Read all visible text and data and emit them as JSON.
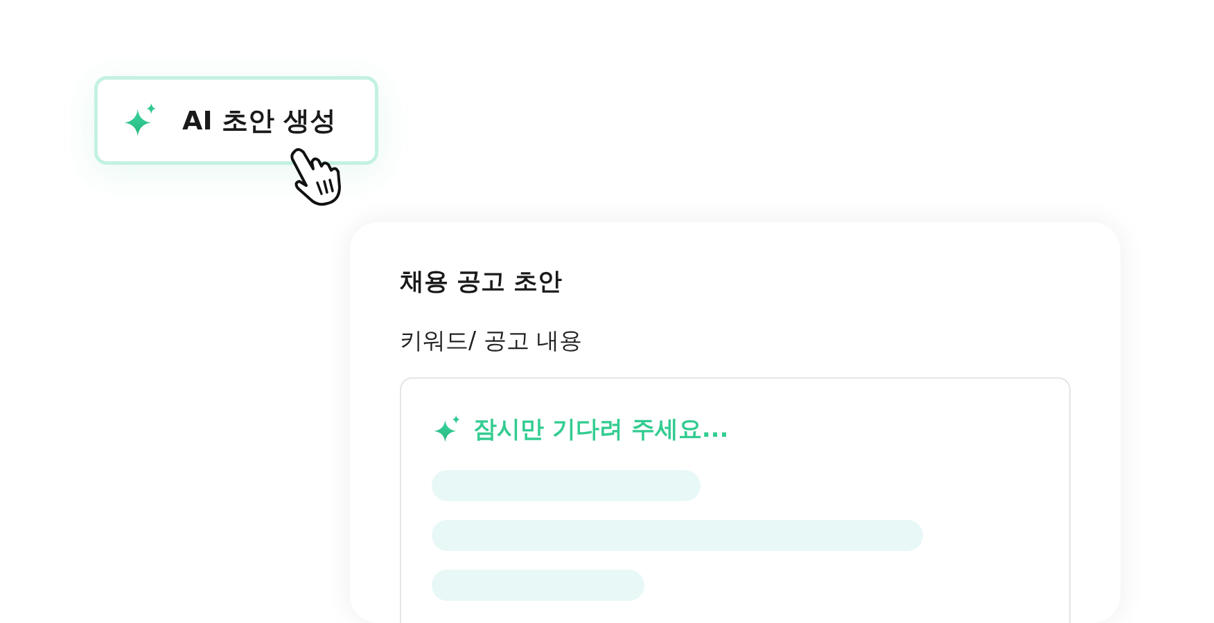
{
  "generate_button": {
    "label": "AI 초안 생성"
  },
  "draft_card": {
    "title": "채용 공고 초안",
    "field_label": "키워드/ 공고 내용",
    "loading_text": "잠시만 기다려 주세요..."
  }
}
